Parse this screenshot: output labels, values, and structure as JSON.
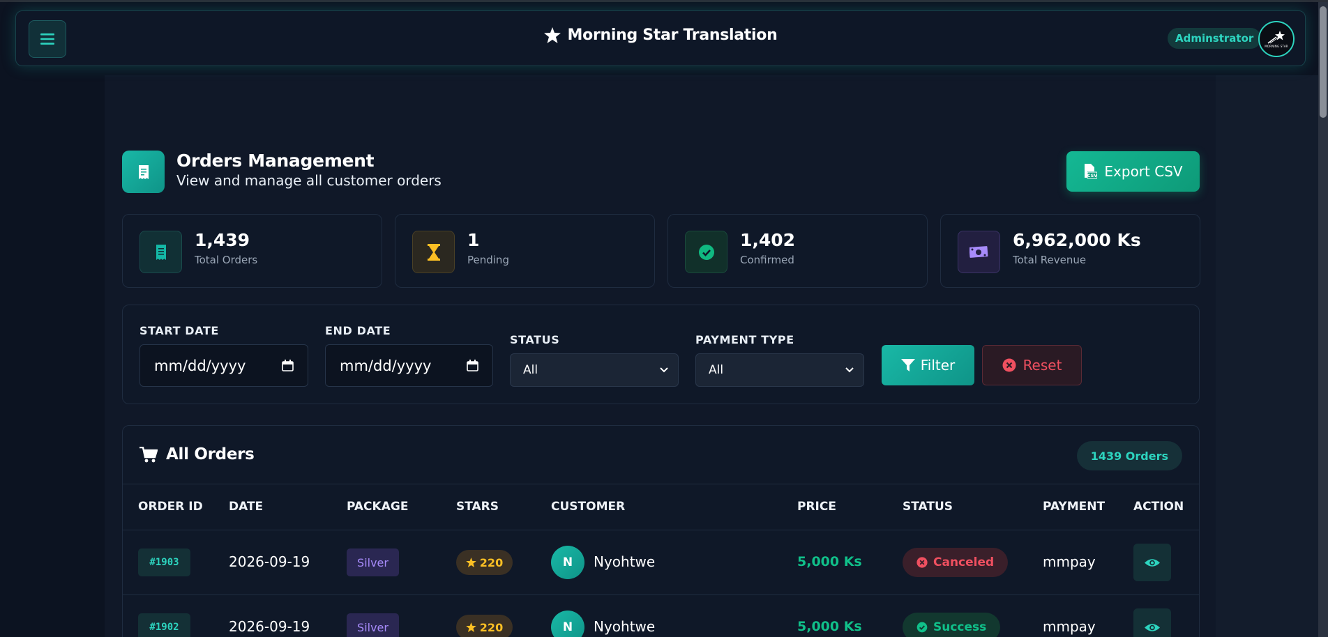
{
  "header": {
    "brand_title": "Morning Star Translation",
    "role_badge": "Adminstrator",
    "logo_text": "MORNING STAR"
  },
  "page": {
    "title": "Orders Management",
    "subtitle": "View and manage all customer orders",
    "export_label": "Export CSV"
  },
  "stats": [
    {
      "value": "1,439",
      "label": "Total Orders",
      "icon": "receipt-icon",
      "color": "#14b8a6"
    },
    {
      "value": "1",
      "label": "Pending",
      "icon": "hourglass-icon",
      "color": "#fbbf24"
    },
    {
      "value": "1,402",
      "label": "Confirmed",
      "icon": "check-circle-icon",
      "color": "#10b981"
    },
    {
      "value": "6,962,000 Ks",
      "label": "Total Revenue",
      "icon": "money-icon",
      "color": "#a78bfa"
    }
  ],
  "filters": {
    "start_date_label": "START DATE",
    "start_date_value": "mm/dd/yyyy",
    "end_date_label": "END DATE",
    "end_date_value": "mm/dd/yyyy",
    "status_label": "STATUS",
    "status_value": "All",
    "payment_label": "PAYMENT TYPE",
    "payment_value": "All",
    "filter_btn": "Filter",
    "reset_btn": "Reset"
  },
  "orders": {
    "title": "All Orders",
    "count_badge": "1439 Orders",
    "columns": [
      "ORDER ID",
      "DATE",
      "PACKAGE",
      "STARS",
      "CUSTOMER",
      "PRICE",
      "STATUS",
      "PAYMENT",
      "ACTION"
    ],
    "rows": [
      {
        "id": "#1903",
        "date": "2026-09-19",
        "package": "Silver",
        "stars": "220",
        "initial": "N",
        "customer": "Nyohtwe",
        "price": "5,000 Ks",
        "status": "Canceled",
        "payment": "mmpay"
      },
      {
        "id": "#1902",
        "date": "2026-09-19",
        "package": "Silver",
        "stars": "220",
        "initial": "N",
        "customer": "Nyohtwe",
        "price": "5,000 Ks",
        "status": "Success",
        "payment": "mmpay"
      }
    ]
  },
  "colors": {
    "accent": "#14b8a6",
    "success": "#10c08a",
    "danger": "#f05060",
    "warning": "#fbbf24",
    "package": "#a78bfa"
  }
}
